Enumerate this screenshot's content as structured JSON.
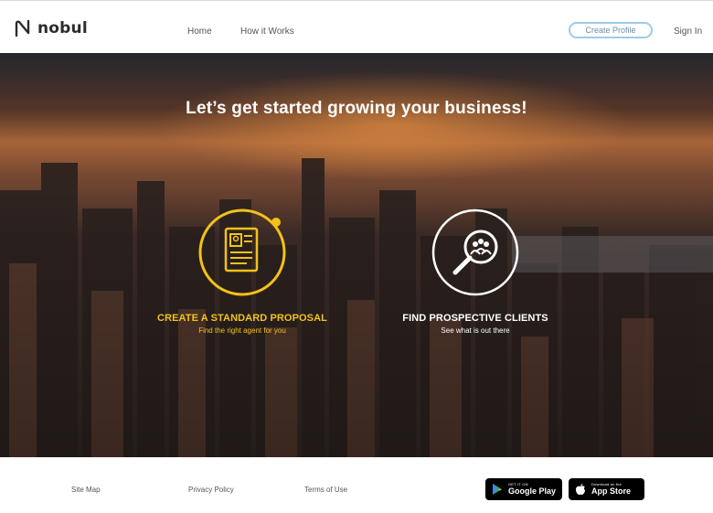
{
  "brand": {
    "name": "nobul"
  },
  "nav": {
    "home": "Home",
    "how_it_works": "How it Works",
    "create_profile": "Create Profile",
    "sign_in": "Sign In"
  },
  "hero": {
    "title": "Let’s get started growing your business!",
    "cards": [
      {
        "title": "CREATE A STANDARD PROPOSAL",
        "subtitle": "Find the right agent for you",
        "icon": "proposal-document-icon",
        "color": "#f2c21a"
      },
      {
        "title": "FIND PROSPECTIVE CLIENTS",
        "subtitle": "See what is out there",
        "icon": "magnifier-people-icon",
        "color": "#ffffff"
      }
    ]
  },
  "footer": {
    "links": [
      "Site Map",
      "Privacy Policy",
      "Terms of Use"
    ],
    "google_play": {
      "small": "GET IT ON",
      "big": "Google Play"
    },
    "app_store": {
      "small": "Download on the",
      "big": "App Store"
    }
  }
}
